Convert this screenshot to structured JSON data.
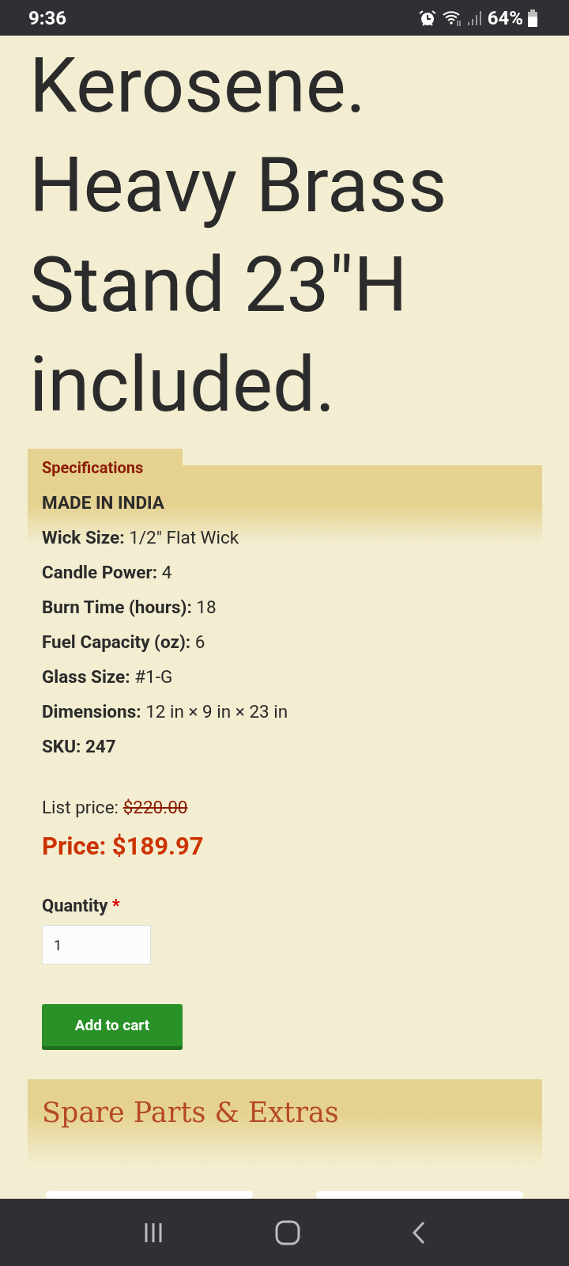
{
  "status_bar": {
    "time": "9:36",
    "battery": "64%"
  },
  "title": "Kerosene. Heavy Brass Stand 23\"H included.",
  "specifications": {
    "heading": "Specifications",
    "origin": "MADE IN INDIA",
    "rows": [
      {
        "label": "Wick Size:",
        "value": "1/2\" Flat Wick"
      },
      {
        "label": "Candle Power:",
        "value": "4"
      },
      {
        "label": "Burn Time (hours):",
        "value": "18"
      },
      {
        "label": "Fuel Capacity (oz):",
        "value": "6"
      },
      {
        "label": "Glass Size:",
        "value": "#1-G"
      },
      {
        "label": "Dimensions:",
        "value": "12 in × 9 in × 23 in"
      }
    ],
    "sku": "SKU: 247"
  },
  "pricing": {
    "list_label": "List price:",
    "list_price": "$220.00",
    "price": "Price: $189.97"
  },
  "quantity": {
    "label": "Quantity",
    "required_mark": "*",
    "value": "1"
  },
  "add_to_cart": "Add to cart",
  "spare_parts": {
    "heading": "Spare Parts & Extras"
  }
}
